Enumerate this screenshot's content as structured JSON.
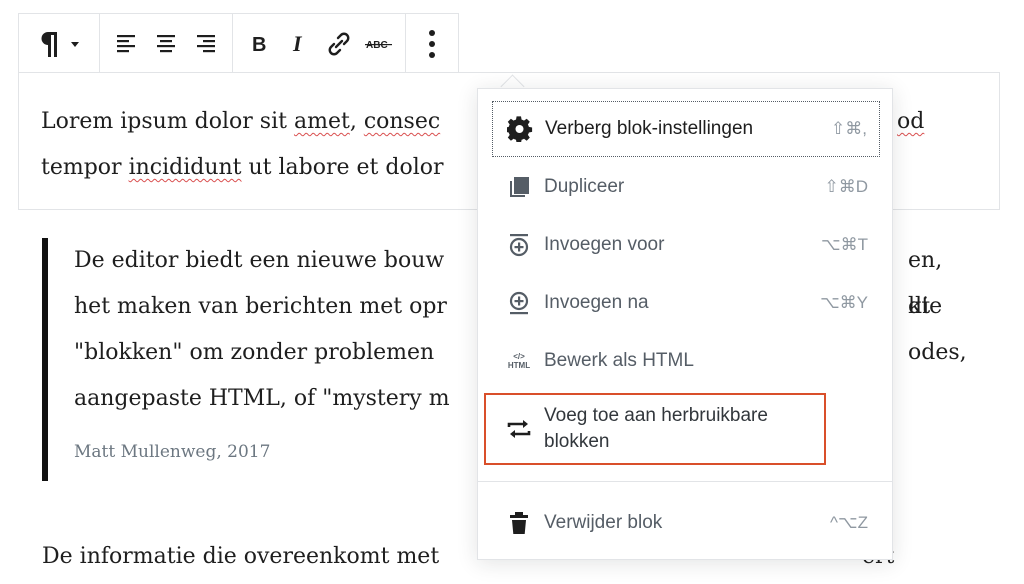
{
  "toolbar": {
    "buttons": [
      {
        "name": "paragraph-transform",
        "icon": "pilcrow-icon"
      },
      {
        "name": "align-left",
        "icon": "align-left-icon"
      },
      {
        "name": "align-center",
        "icon": "align-center-icon"
      },
      {
        "name": "align-right",
        "icon": "align-right-icon"
      },
      {
        "name": "bold",
        "icon": "bold-icon"
      },
      {
        "name": "italic",
        "icon": "italic-icon"
      },
      {
        "name": "link",
        "icon": "link-icon"
      },
      {
        "name": "strikethrough",
        "icon": "strikethrough-icon"
      },
      {
        "name": "more-options",
        "icon": "vertical-ellipsis-icon"
      }
    ],
    "strike_label": "ABC"
  },
  "paragraph": {
    "line1_a": "Lorem ipsum dolor sit ",
    "line1_amet": "amet",
    "line1_b": ", ",
    "line1_consec": "consec",
    "line1_end": "od",
    "line2_a": "tempor ",
    "line2_incididunt": "incididunt",
    "line2_b": " ut labore et dolor"
  },
  "quote": {
    "lines": [
      {
        "left": "De editor biedt een nieuwe bouw",
        "right": "en, die"
      },
      {
        "left": "het maken van berichten met opr",
        "right": "kt"
      },
      {
        "left": "\"blokken\" om zonder problemen",
        "right": "odes,"
      },
      {
        "left": "aangepaste HTML, of \"mystery m",
        "right": ""
      }
    ],
    "citation": "Matt Mullenweg, 2017"
  },
  "paragraph2": {
    "text": "De informatie die overeenkomt met",
    "tail": "ert"
  },
  "menu": {
    "items": [
      {
        "label": "Verberg blok-instellingen",
        "shortcut": "⇧⌘,",
        "icon": "gear-icon"
      },
      {
        "label": "Dupliceer",
        "shortcut": "⇧⌘D",
        "icon": "duplicate-icon"
      },
      {
        "label": "Invoegen voor",
        "shortcut": "⌥⌘T",
        "icon": "insert-before-icon"
      },
      {
        "label": "Invoegen na",
        "shortcut": "⌥⌘Y",
        "icon": "insert-after-icon"
      },
      {
        "label": "Bewerk als HTML",
        "shortcut": "",
        "icon": "html-icon"
      },
      {
        "label": "Voeg toe aan herbruikbare",
        "label2": "blokken",
        "shortcut": "",
        "icon": "reusable-block-icon"
      },
      {
        "label": "Verwijder blok",
        "shortcut": "^⌥Z",
        "icon": "trash-icon"
      }
    ],
    "html_icon_text": "HTML"
  },
  "colors": {
    "highlight_border": "#d94f2a",
    "menu_text": "#555d66",
    "shortcut_text": "#8f98a1",
    "quote_bar": "#111111"
  }
}
